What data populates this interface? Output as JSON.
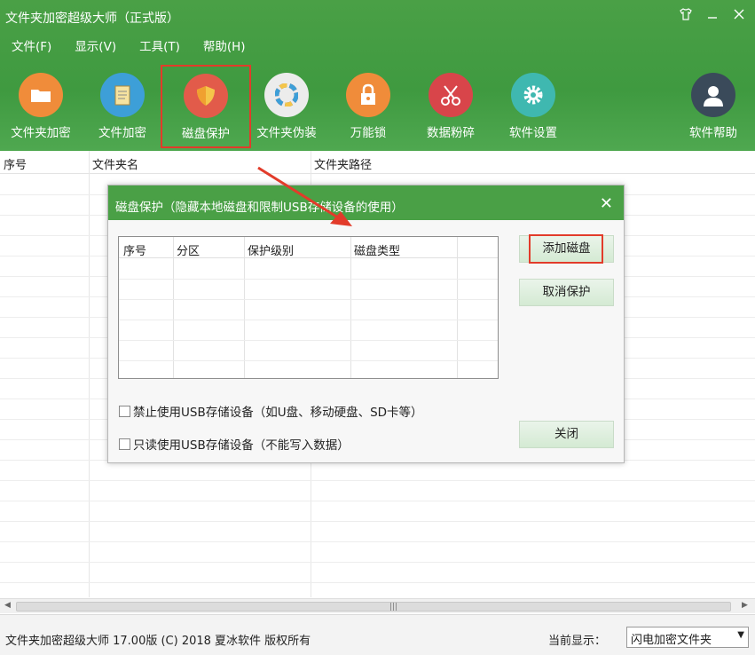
{
  "window": {
    "title": "文件夹加密超级大师（正式版）",
    "controls": [
      "shirt-icon",
      "minimize-icon",
      "close-icon"
    ]
  },
  "menu": [
    {
      "label": "文件(F)"
    },
    {
      "label": "显示(V)"
    },
    {
      "label": "工具(T)"
    },
    {
      "label": "帮助(H)"
    }
  ],
  "toolbar": [
    {
      "label": "文件夹加密",
      "icon": "folder-icon",
      "color": "#f08c3a"
    },
    {
      "label": "文件加密",
      "icon": "file-icon",
      "color": "#3d9fd8"
    },
    {
      "label": "磁盘保护",
      "icon": "shield-icon",
      "color": "#e25b4a",
      "selected": true
    },
    {
      "label": "文件夹伪装",
      "icon": "color-wheel-icon",
      "color": "#e8e8e8"
    },
    {
      "label": "万能锁",
      "icon": "lock-icon",
      "color": "#f08c3a"
    },
    {
      "label": "数据粉碎",
      "icon": "scissors-icon",
      "color": "#d8454a"
    },
    {
      "label": "软件设置",
      "icon": "gear-icon",
      "color": "#3fb8b0"
    },
    {
      "label": "软件帮助",
      "icon": "user-icon",
      "color": "#3a4a5a"
    }
  ],
  "table": {
    "columns": [
      "序号",
      "文件夹名",
      "文件夹路径"
    ]
  },
  "dialog": {
    "title": "磁盘保护（隐藏本地磁盘和限制USB存储设备的使用）",
    "columns": [
      "序号",
      "分区",
      "保护级别",
      "磁盘类型"
    ],
    "buttons": {
      "add": "添加磁盘",
      "cancel": "取消保护",
      "close": "关闭"
    },
    "checkboxes": [
      {
        "label": "禁止使用USB存储设备（如U盘、移动硬盘、SD卡等）",
        "checked": false
      },
      {
        "label": "只读使用USB存储设备（不能写入数据）",
        "checked": false
      }
    ]
  },
  "status": {
    "copyright": "文件夹加密超级大师 17.00版 (C) 2018  夏冰软件 版权所有",
    "current_label": "当前显示：",
    "current_value": "闪电加密文件夹"
  },
  "colors": {
    "header_green": "#4aa046",
    "highlight_red": "#e23b2a",
    "button_green": "#d4ead3"
  }
}
